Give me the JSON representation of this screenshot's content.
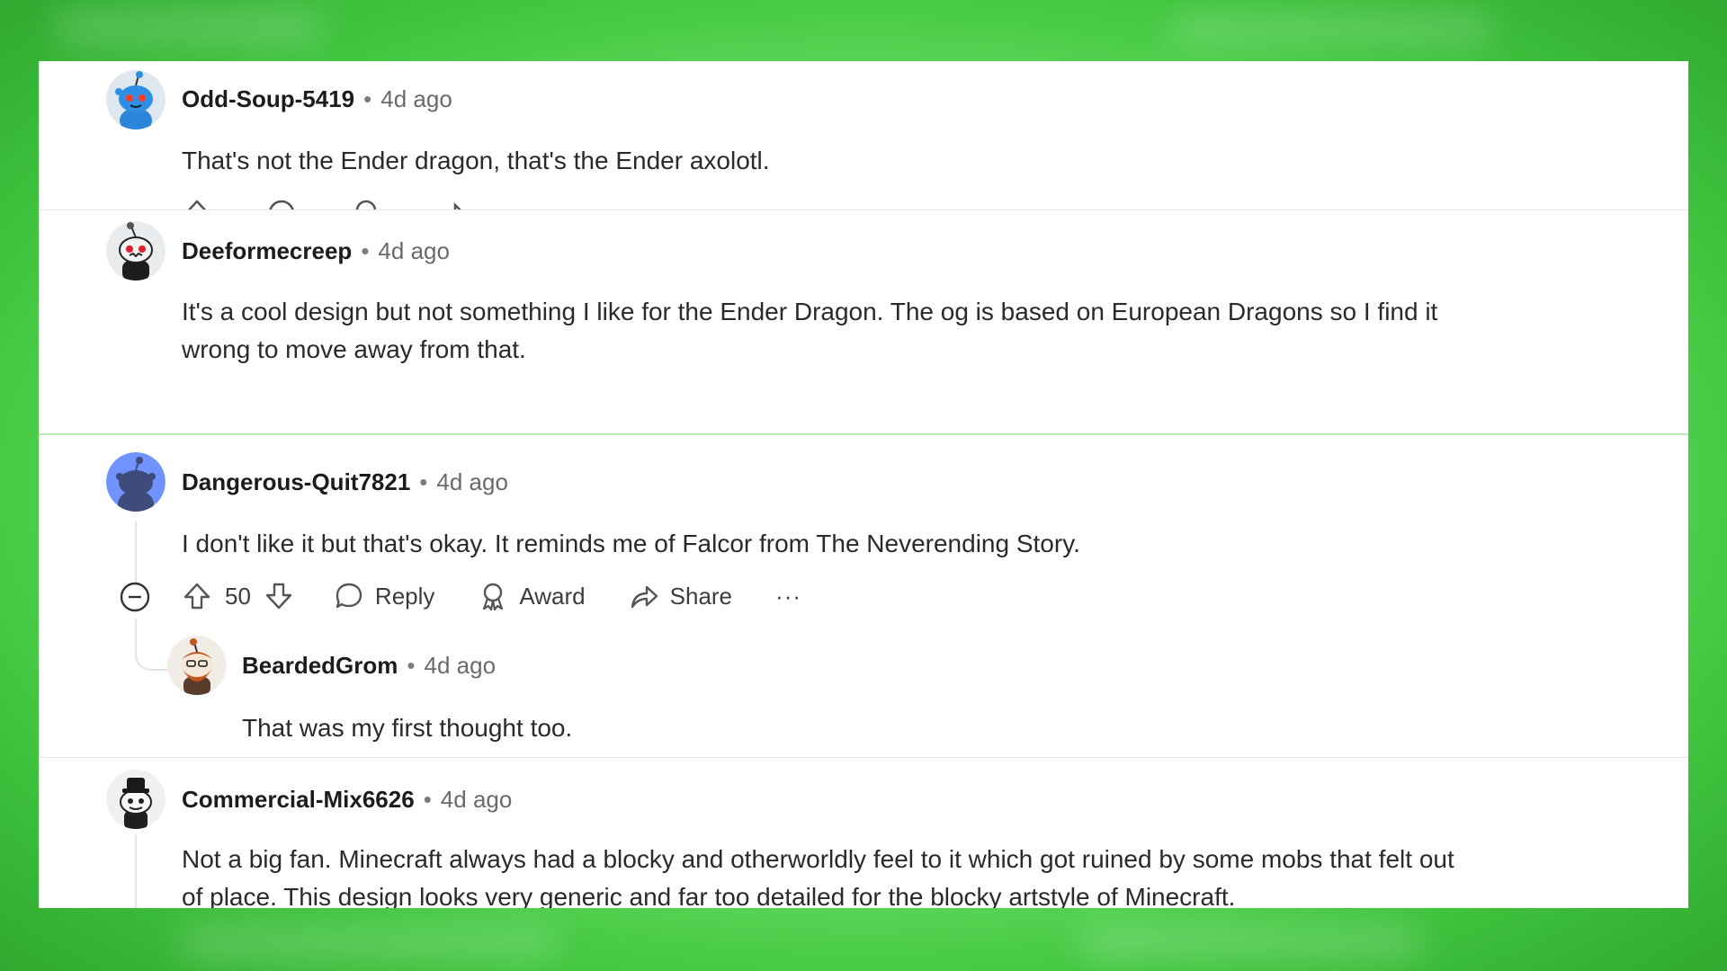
{
  "comments": [
    {
      "author": "Odd-Soup-5419",
      "time": "4d ago",
      "body": "That's not the Ender dragon, that's the Ender axolotl.",
      "avatar": "reddit-snoo-avatar-blue"
    },
    {
      "author": "Deeformecreep",
      "time": "4d ago",
      "body": "It's a cool design but not something I like for the Ender Dragon. The og is based on European Dragons so I find it wrong to move away from that.",
      "avatar": "reddit-snoo-avatar-dark"
    },
    {
      "author": "Dangerous-Quit7821",
      "time": "4d ago",
      "body": "I don't like it but that's okay. It reminds me of Falcor from The Neverending Story.",
      "avatar": "reddit-snoo-avatar-purple",
      "votes": "50",
      "actions": {
        "reply": "Reply",
        "award": "Award",
        "share": "Share",
        "more": "···"
      },
      "replies": [
        {
          "author": "BeardedGrom",
          "time": "4d ago",
          "body": "That was my first thought too.",
          "avatar": "reddit-snoo-avatar-bearded"
        }
      ]
    },
    {
      "author": "Commercial-Mix6626",
      "time": "4d ago",
      "body": "Not a big fan. Minecraft always had a blocky and otherworldly feel to it which got ruined by some mobs that felt out of place. This design looks very generic and far too detailed for the blocky artstyle of Minecraft.",
      "avatar": "reddit-snoo-avatar-hat"
    }
  ],
  "meta_separator": "•",
  "colors": {
    "background_green": "#6ee56b",
    "card": "#ffffff",
    "text": "#2a2a2a",
    "muted": "#6a6a6a"
  }
}
